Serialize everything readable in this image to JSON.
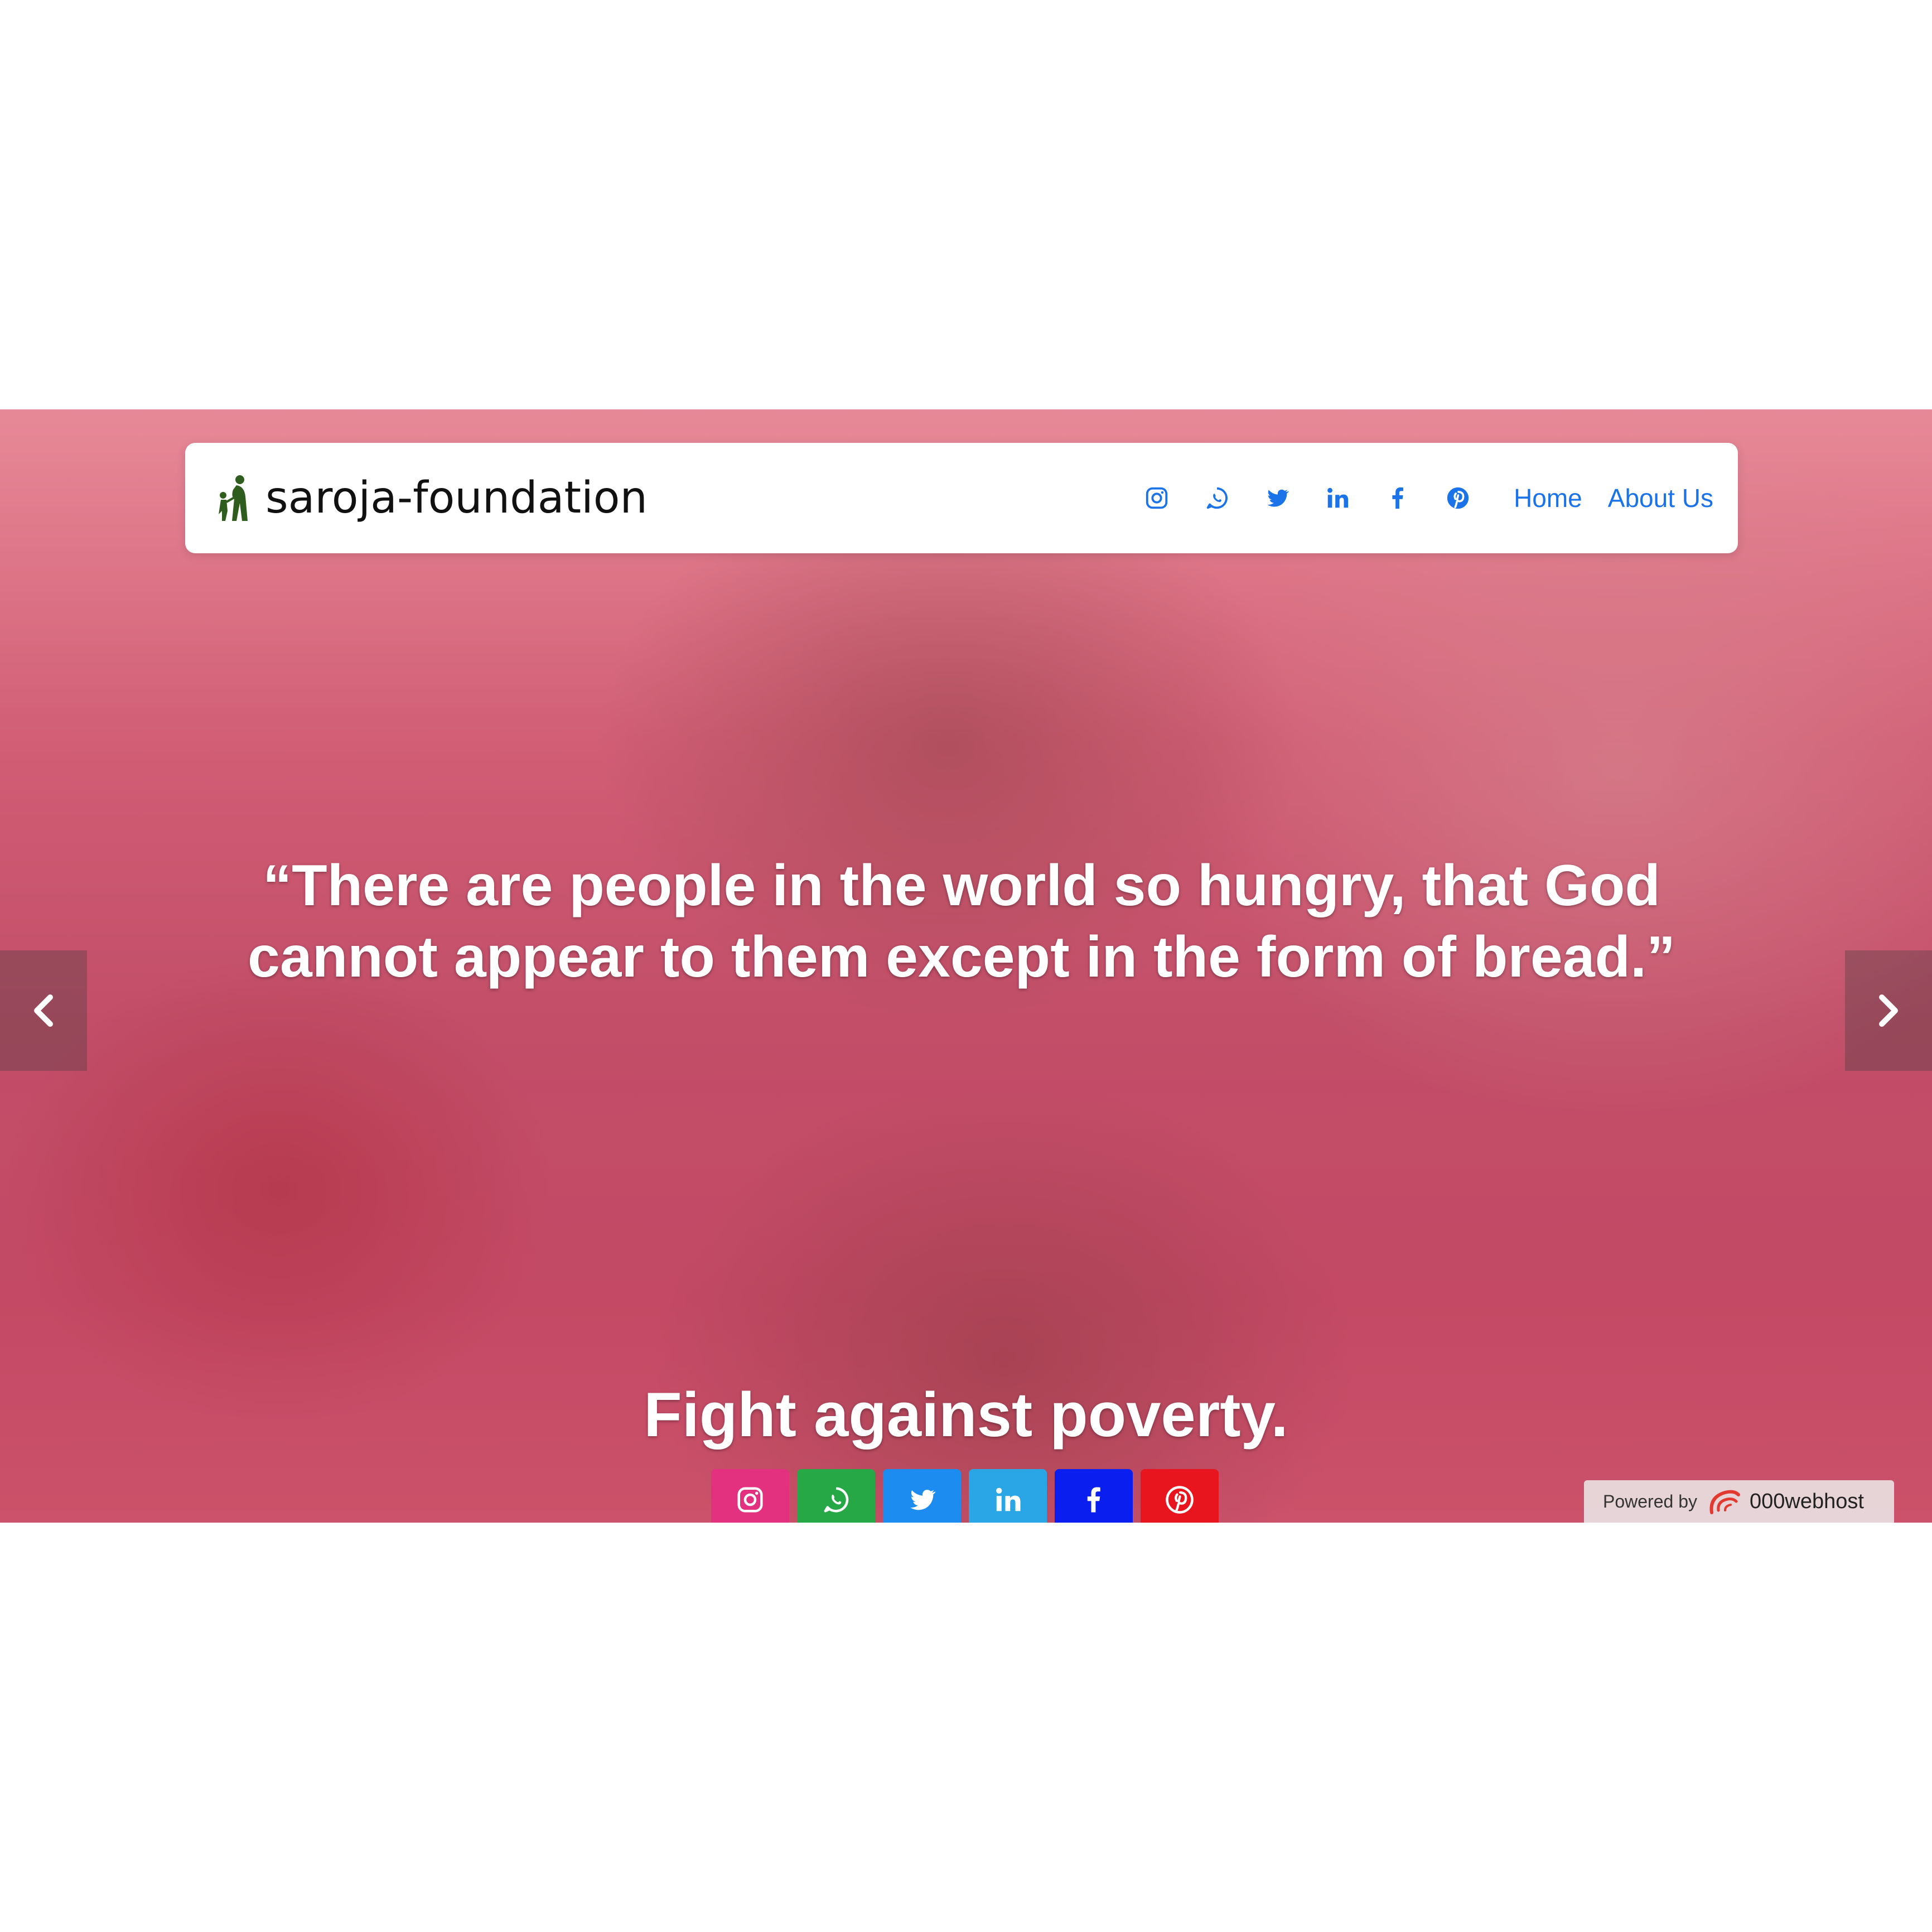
{
  "navbar": {
    "brand": "saroja-foundation",
    "links": [
      {
        "label": "Home"
      },
      {
        "label": "About Us"
      }
    ],
    "social_icons": [
      "instagram-icon",
      "whatsapp-icon",
      "twitter-icon",
      "linkedin-icon",
      "facebook-icon",
      "pinterest-icon"
    ],
    "link_color": "#1a73e8"
  },
  "hero": {
    "quote": "“There are people in the world so hungry, that God cannot appear to them except in the form of bread.”",
    "tagline": "Fight against poverty.",
    "overlay_color": "#e83e78"
  },
  "carousel": {
    "prev_icon": "chevron-left-icon",
    "next_icon": "chevron-right-icon"
  },
  "social_buttons": [
    {
      "name": "instagram",
      "icon": "instagram-icon",
      "color": "#e4317f"
    },
    {
      "name": "whatsapp",
      "icon": "whatsapp-icon",
      "color": "#25a845"
    },
    {
      "name": "twitter",
      "icon": "twitter-icon",
      "color": "#1d8cf0"
    },
    {
      "name": "linkedin",
      "icon": "linkedin-icon",
      "color": "#2aa5e6"
    },
    {
      "name": "facebook",
      "icon": "facebook-icon",
      "color": "#0a1ef0"
    },
    {
      "name": "pinterest",
      "icon": "pinterest-icon",
      "color": "#e8141e"
    }
  ],
  "powered_by": {
    "label": "Powered by",
    "host": "000webhost"
  }
}
